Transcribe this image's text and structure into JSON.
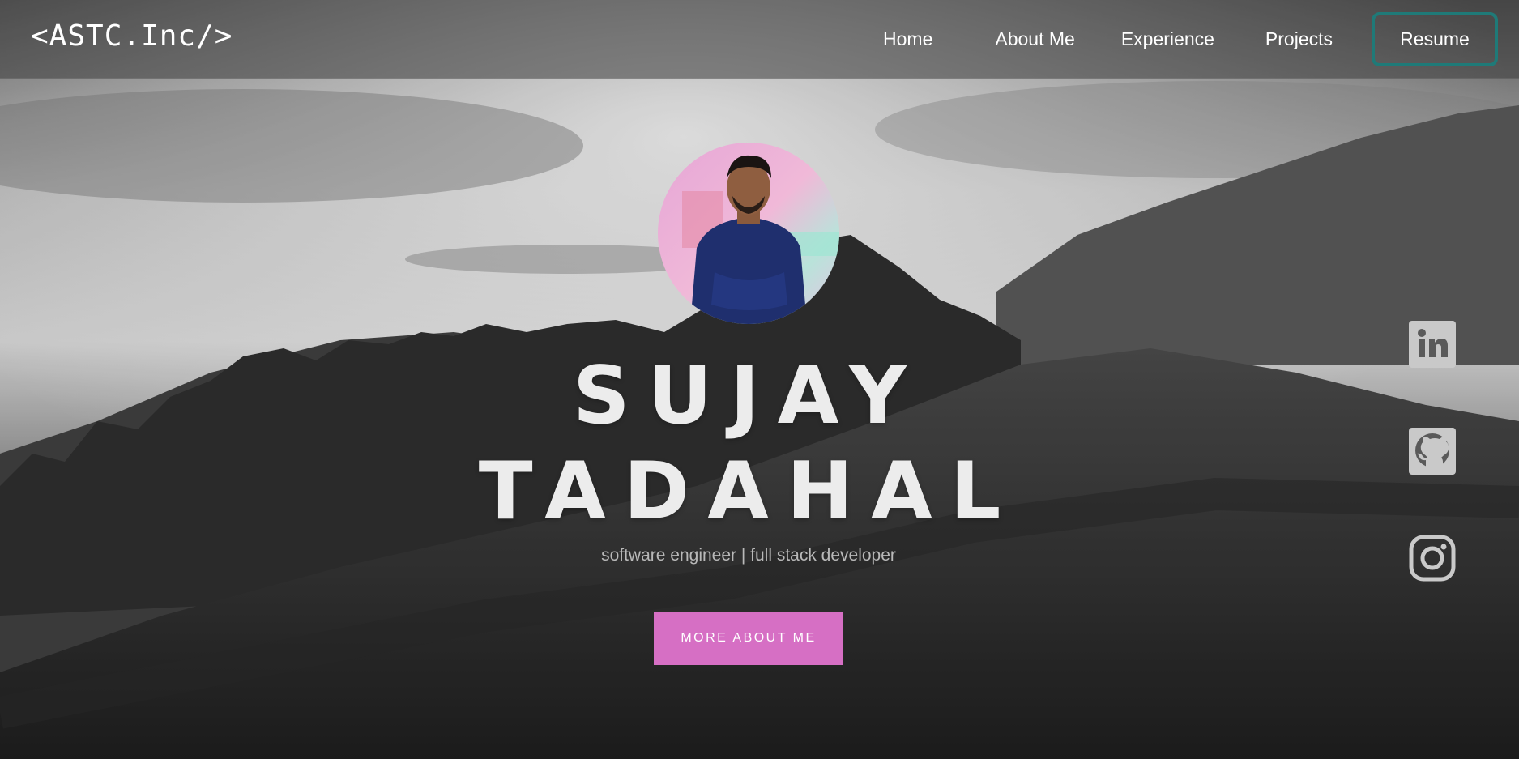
{
  "navbar": {
    "brand": "<ASTC.Inc/>",
    "links": [
      {
        "label": "Home"
      },
      {
        "label": "About Me"
      },
      {
        "label": "Experience"
      },
      {
        "label": "Projects"
      }
    ],
    "resume_label": "Resume",
    "resume_border_color": "#1f7a78"
  },
  "hero": {
    "first_name": "SUJAY",
    "last_name": "TADAHAL",
    "tagline": "software engineer | full stack developer",
    "cta_label": "MORE ABOUT ME",
    "cta_color": "#d66fc4"
  },
  "social": {
    "icons": [
      "linkedin-icon",
      "github-icon",
      "instagram-icon"
    ]
  }
}
